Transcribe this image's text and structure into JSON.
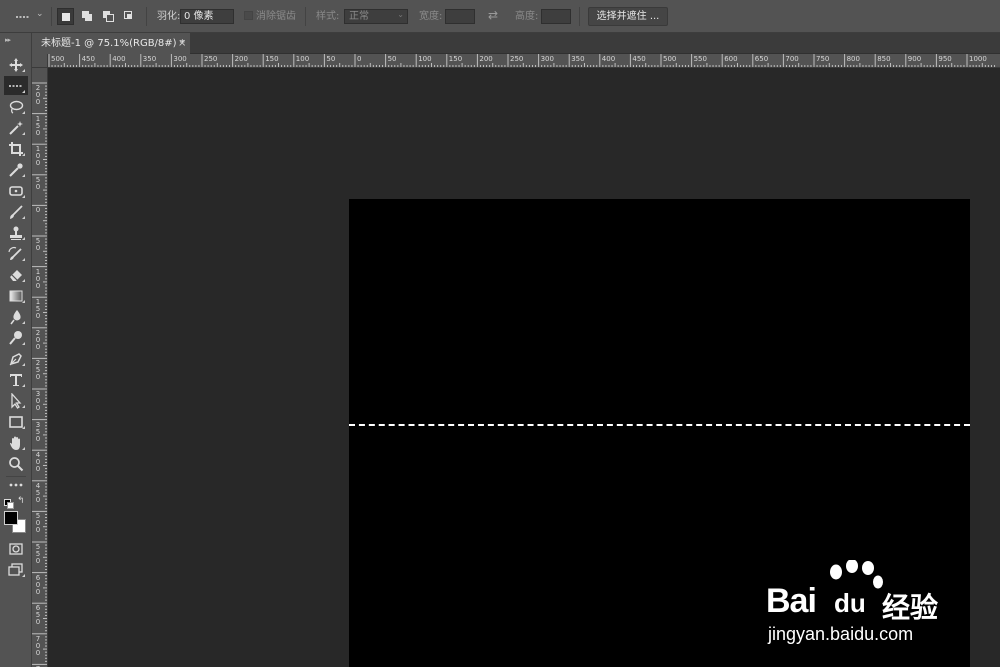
{
  "options_bar": {
    "feather_label": "羽化:",
    "feather_value": "0 像素",
    "antialias_label": "消除锯齿",
    "style_label": "样式:",
    "style_value": "正常",
    "width_label": "宽度:",
    "height_label": "高度:",
    "select_mask_label": "选择并遮住 ..."
  },
  "document_tab": {
    "title": "未标题-1 @ 75.1%(RGB/8#) *",
    "close": "×"
  },
  "h_ruler": [
    "500",
    "450",
    "400",
    "350",
    "300",
    "250",
    "200",
    "150",
    "100",
    "50",
    "0",
    "50",
    "100",
    "150",
    "200",
    "250",
    "300",
    "350",
    "400",
    "450",
    "500",
    "550",
    "600",
    "650",
    "700",
    "750",
    "800",
    "850",
    "900",
    "950",
    "1000"
  ],
  "v_ruler": [
    "200",
    "150",
    "100",
    "50",
    "0",
    "50",
    "100",
    "150",
    "200",
    "250",
    "300",
    "350",
    "400",
    "450",
    "500",
    "550",
    "600",
    "650",
    "700",
    "750"
  ],
  "toolbar": {
    "tools": [
      "move-tool",
      "single-row-marquee-tool",
      "lasso-tool",
      "magic-wand-tool",
      "crop-tool",
      "eyedropper-tool",
      "patch-tool",
      "brush-tool",
      "clone-stamp-tool",
      "history-brush-tool",
      "eraser-tool",
      "gradient-tool",
      "blur-tool",
      "dodge-tool",
      "pen-tool",
      "type-tool",
      "path-selection-tool",
      "rectangle-tool",
      "hand-tool",
      "zoom-tool",
      "more-tools"
    ],
    "foreground_color": "#000000",
    "background_color": "#ffffff"
  },
  "canvas": {
    "background": "#000000"
  },
  "watermark": {
    "brand": "Bai",
    "brand_mid": "du",
    "brand_cn": "经验",
    "url": "jingyan.baidu.com"
  }
}
